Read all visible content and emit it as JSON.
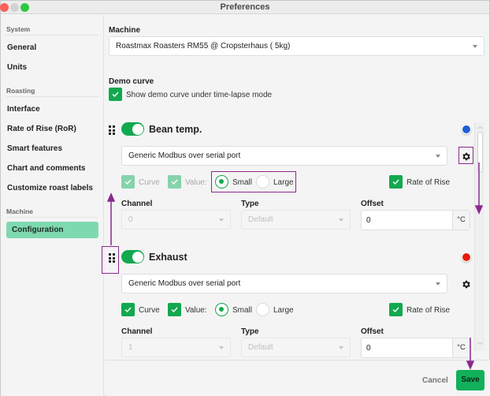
{
  "window": {
    "title": "Preferences"
  },
  "sidebar": {
    "sections": [
      {
        "label": "System",
        "items": [
          {
            "label": "General"
          },
          {
            "label": "Units"
          }
        ]
      },
      {
        "label": "Roasting",
        "items": [
          {
            "label": "Interface"
          },
          {
            "label": "Rate of Rise (RoR)"
          },
          {
            "label": "Smart features"
          },
          {
            "label": "Chart and comments"
          },
          {
            "label": "Customize roast labels"
          }
        ]
      },
      {
        "label": "Machine",
        "items": [
          {
            "label": "Configuration",
            "active": true
          }
        ]
      }
    ]
  },
  "machine": {
    "label": "Machine",
    "selected": "Roastmax Roasters RM55 @ Cropsterhaus ( 5kg)"
  },
  "demo_curve": {
    "label": "Demo curve",
    "checkbox_label": "Show demo curve under time-lapse mode",
    "checked": true
  },
  "sensors": [
    {
      "name": "Bean temp.",
      "enabled": true,
      "color": "#1e5fd6",
      "driver": "Generic Modbus over serial port",
      "curve": {
        "label": "Curve",
        "checked": true,
        "disabled": true
      },
      "value": {
        "label": "Value:",
        "checked": true,
        "disabled": true
      },
      "size_options": [
        {
          "label": "Small",
          "selected": true
        },
        {
          "label": "Large",
          "selected": false
        }
      ],
      "rate_of_rise": {
        "label": "Rate of Rise",
        "checked": true
      },
      "channel": {
        "label": "Channel",
        "value": "0"
      },
      "type": {
        "label": "Type",
        "value": "Default"
      },
      "offset": {
        "label": "Offset",
        "value": "0",
        "unit": "°C"
      }
    },
    {
      "name": "Exhaust",
      "enabled": true,
      "color": "#e8190c",
      "driver": "Generic Modbus over serial port",
      "curve": {
        "label": "Curve",
        "checked": true,
        "disabled": false
      },
      "value": {
        "label": "Value:",
        "checked": true,
        "disabled": false
      },
      "size_options": [
        {
          "label": "Small",
          "selected": true
        },
        {
          "label": "Large",
          "selected": false
        }
      ],
      "rate_of_rise": {
        "label": "Rate of Rise",
        "checked": true
      },
      "channel": {
        "label": "Channel",
        "value": "1"
      },
      "type": {
        "label": "Type",
        "value": "Default"
      },
      "offset": {
        "label": "Offset",
        "value": "0",
        "unit": "°C"
      }
    }
  ],
  "footer": {
    "cancel_label": "Cancel",
    "save_label": "Save"
  },
  "annotation_color": "#8a2a8e"
}
